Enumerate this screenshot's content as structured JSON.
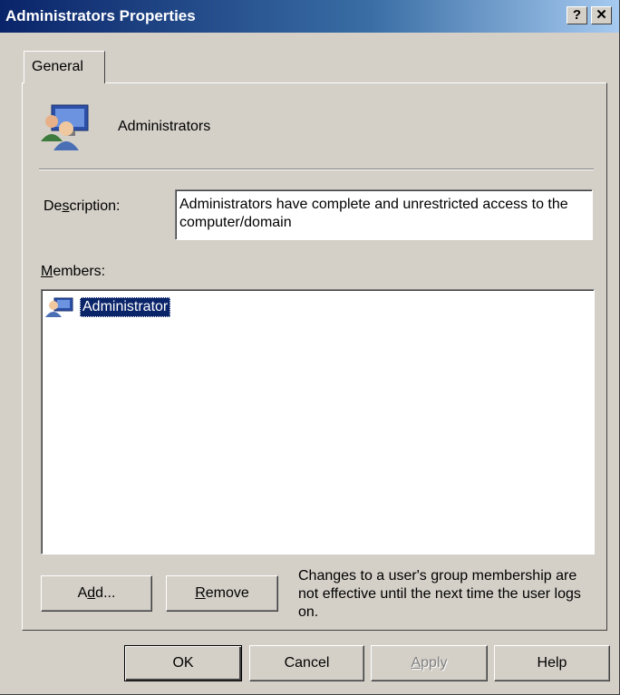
{
  "window": {
    "title": "Administrators Properties",
    "help_button": "?",
    "close_button": "✕"
  },
  "tabs": [
    {
      "label": "General",
      "selected": true
    }
  ],
  "group": {
    "name": "Administrators",
    "icon": "group-users-icon"
  },
  "description": {
    "label": "Description:",
    "value": "Administrators have complete and unrestricted access to the computer/domain"
  },
  "members": {
    "label": "Members:",
    "items": [
      {
        "name": "Administrator",
        "icon": "user-icon",
        "selected": true
      }
    ]
  },
  "member_buttons": {
    "add": "Add...",
    "remove": "Remove"
  },
  "note": "Changes to a user's group membership are not effective until the next time the user logs on.",
  "dialog_buttons": {
    "ok": "OK",
    "cancel": "Cancel",
    "apply": "Apply",
    "help": "Help"
  },
  "colors": {
    "selection": "#0a246a",
    "face": "#d4d0c8"
  }
}
